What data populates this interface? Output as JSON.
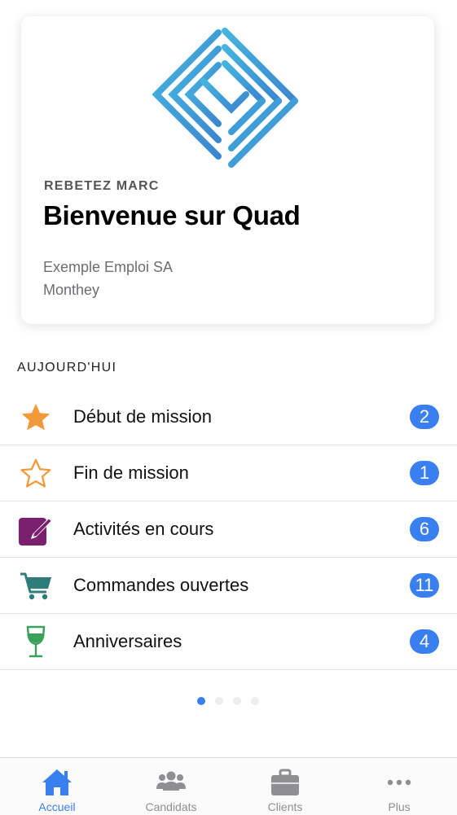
{
  "header": {
    "user_name": "REBETEZ MARC",
    "welcome": "Bienvenue sur Quad",
    "company": "Exemple Emploi SA",
    "city": "Monthey",
    "logo_icon": "quad-diamond-logo"
  },
  "today": {
    "title": "AUJOURD'HUI",
    "items": [
      {
        "label": "Début de mission",
        "count": "2",
        "icon": "star-filled-icon",
        "color": "#f29a3a"
      },
      {
        "label": "Fin de mission",
        "count": "1",
        "icon": "star-outline-icon",
        "color": "#f29a3a"
      },
      {
        "label": "Activités en cours",
        "count": "6",
        "icon": "edit-square-icon",
        "color": "#7b1f6f"
      },
      {
        "label": "Commandes ouvertes",
        "count": "11",
        "icon": "cart-icon",
        "color": "#2e7d7a"
      },
      {
        "label": "Anniversaires",
        "count": "4",
        "icon": "wine-glass-icon",
        "color": "#3aa05a"
      }
    ]
  },
  "pager": {
    "current": 1,
    "total": 4
  },
  "tabs": [
    {
      "label": "Accueil",
      "icon": "home-icon",
      "active": true
    },
    {
      "label": "Candidats",
      "icon": "people-icon",
      "active": false
    },
    {
      "label": "Clients",
      "icon": "briefcase-icon",
      "active": false
    },
    {
      "label": "Plus",
      "icon": "more-icon",
      "active": false
    }
  ],
  "colors": {
    "accent": "#3a7ff0",
    "inactive": "#8e8e93"
  }
}
